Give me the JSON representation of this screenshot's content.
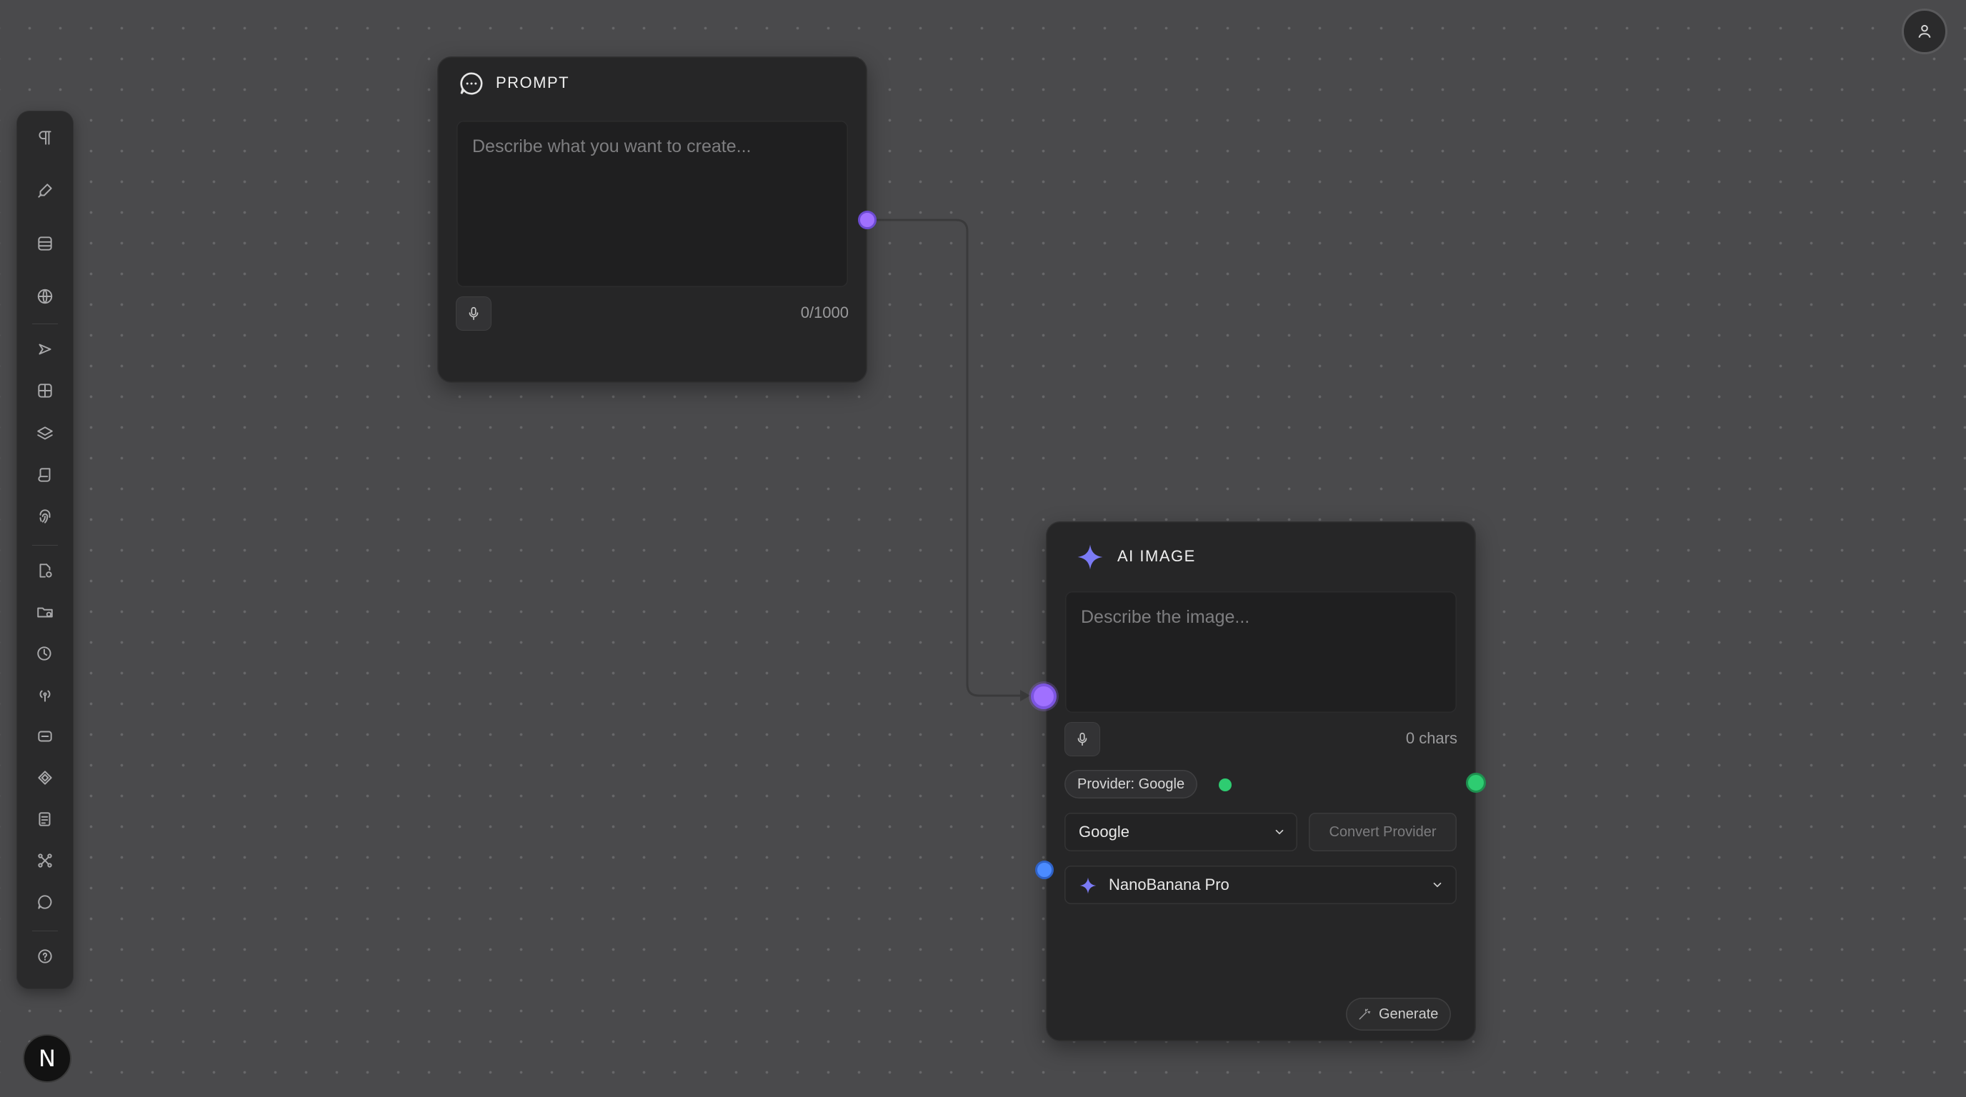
{
  "prompt_node": {
    "title": "PROMPT",
    "placeholder": "Describe what you want to create...",
    "char_counter": "0/1000"
  },
  "ai_image_node": {
    "title": "AI IMAGE",
    "placeholder": "Describe the image...",
    "char_counter": "0 chars",
    "provider_badge": "Provider: Google",
    "provider_select": "Google",
    "convert_button": "Convert Provider",
    "model_select": "NanoBanana Pro",
    "generate_button": "Generate"
  },
  "workspace_badge": "N",
  "toolbar": {
    "icons": [
      "paragraph-icon",
      "pen-icon",
      "database-icon",
      "globe-icon",
      "send-icon",
      "grid-icon",
      "layers-icon",
      "scroll-icon",
      "fingerprint-icon",
      "file-settings-icon",
      "folder-icon",
      "clock-icon",
      "broadcast-icon",
      "frame-icon",
      "diamond-icon",
      "notes-icon",
      "network-icon",
      "chat-icon",
      "help-icon"
    ]
  },
  "colors": {
    "canvas": "#4a4a4c",
    "node": "#262627",
    "purple_handle": "#a070ff",
    "green_status": "#2ecc71",
    "blue_handle": "#4b8bff",
    "sparkle": "#7b7bf5"
  }
}
